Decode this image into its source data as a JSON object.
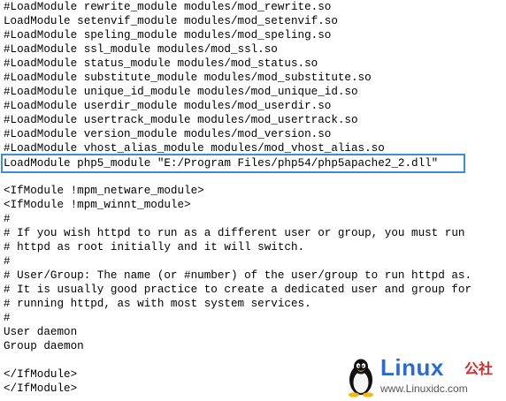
{
  "editor": {
    "lines": [
      "#LoadModule rewrite_module modules/mod_rewrite.so",
      "LoadModule setenvif_module modules/mod_setenvif.so",
      "#LoadModule speling_module modules/mod_speling.so",
      "#LoadModule ssl_module modules/mod_ssl.so",
      "#LoadModule status_module modules/mod_status.so",
      "#LoadModule substitute_module modules/mod_substitute.so",
      "#LoadModule unique_id_module modules/mod_unique_id.so",
      "#LoadModule userdir_module modules/mod_userdir.so",
      "#LoadModule usertrack_module modules/mod_usertrack.so",
      "#LoadModule version_module modules/mod_version.so",
      "#LoadModule vhost_alias_module modules/mod_vhost_alias.so",
      "LoadModule php5_module \"E:/Program Files/php54/php5apache2_2.dll\"",
      "",
      "<IfModule !mpm_netware_module>",
      "<IfModule !mpm_winnt_module>",
      "#",
      "# If you wish httpd to run as a different user or group, you must run",
      "# httpd as root initially and it will switch.",
      "#",
      "# User/Group: The name (or #number) of the user/group to run httpd as.",
      "# It is usually good practice to create a dedicated user and group for",
      "# running httpd, as with most system services.",
      "#",
      "User daemon",
      "Group daemon",
      "",
      "</IfModule>",
      "</IfModule>"
    ],
    "highlighted_line_index": 11,
    "highlight_color": "#3a8fd9"
  },
  "watermark": {
    "brand": "Linux",
    "brand_cn": "公社",
    "url": "www.Linuxidc.com",
    "brand_color": "#2a6bd1",
    "brand_cn_color": "#d62a2a"
  }
}
